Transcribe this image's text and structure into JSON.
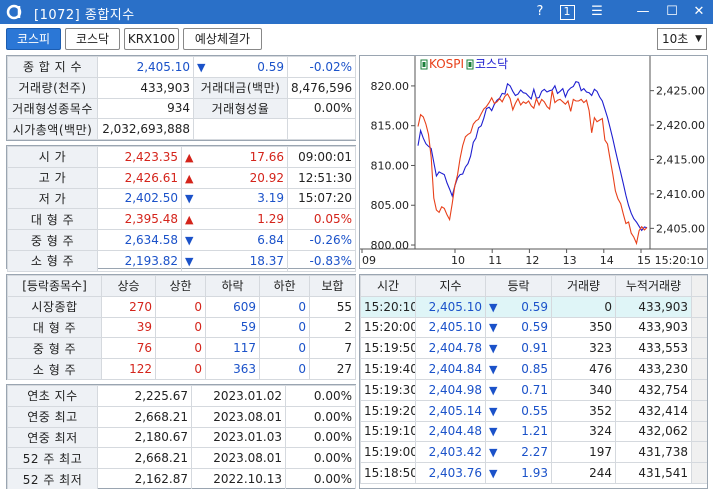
{
  "window": {
    "title": "[1072] 종합지수",
    "controls": [
      "?",
      "1",
      "☰",
      "—",
      "☐",
      "✕"
    ]
  },
  "tabs": [
    {
      "label": "코스피",
      "active": true
    },
    {
      "label": "코스닥",
      "active": false
    },
    {
      "label": "KRX100",
      "active": false
    },
    {
      "label": "예상체결가",
      "active": false
    }
  ],
  "interval": {
    "value": "10초"
  },
  "summary": {
    "rows": [
      {
        "label": "종 합 지 수",
        "value": "2,405.10",
        "arrow": "down",
        "change": "0.59",
        "pct": "-0.02%"
      },
      {
        "label": "거래량(천주)",
        "value": "433,903",
        "label2": "거래대금(백만)",
        "value2": "8,476,596"
      },
      {
        "label": "거래형성종목수",
        "value": "934",
        "label2": "거래형성율",
        "value2": "0.00%"
      },
      {
        "label": "시가총액(백만)",
        "value": "2,032,693,888"
      }
    ]
  },
  "prices": [
    {
      "label": "시 가",
      "value": "2,423.35",
      "arrow": "up",
      "change": "17.66",
      "extra": "09:00:01"
    },
    {
      "label": "고 가",
      "value": "2,426.61",
      "arrow": "up",
      "change": "20.92",
      "extra": "12:51:30"
    },
    {
      "label": "저 가",
      "value": "2,402.50",
      "arrow": "down",
      "change": "3.19",
      "extra": "15:07:20"
    },
    {
      "label": "대 형 주",
      "value": "2,395.48",
      "arrow": "up",
      "change": "1.29",
      "extra": "0.05%"
    },
    {
      "label": "중 형 주",
      "value": "2,634.58",
      "arrow": "down",
      "change": "6.84",
      "extra": "-0.26%"
    },
    {
      "label": "소 형 주",
      "value": "2,193.82",
      "arrow": "down",
      "change": "18.37",
      "extra": "-0.83%"
    }
  ],
  "breadth": {
    "headers": [
      "[등락종목수]",
      "상승",
      "상한",
      "하락",
      "하한",
      "보합"
    ],
    "rows": [
      {
        "label": "시장종합",
        "vals": [
          "270",
          "0",
          "609",
          "0",
          "55"
        ]
      },
      {
        "label": "대 형 주",
        "vals": [
          "39",
          "0",
          "59",
          "0",
          "2"
        ]
      },
      {
        "label": "중 형 주",
        "vals": [
          "76",
          "0",
          "117",
          "0",
          "7"
        ]
      },
      {
        "label": "소 형 주",
        "vals": [
          "122",
          "0",
          "363",
          "0",
          "27"
        ]
      }
    ]
  },
  "yearly": {
    "rows": [
      {
        "label": "연초 지수",
        "value": "2,225.67",
        "date": "2023.01.02",
        "pct": "0.00%"
      },
      {
        "label": "연중 최고",
        "value": "2,668.21",
        "date": "2023.08.01",
        "pct": "0.00%"
      },
      {
        "label": "연중 최저",
        "value": "2,180.67",
        "date": "2023.01.03",
        "pct": "0.00%"
      },
      {
        "label": "52 주 최고",
        "value": "2,668.21",
        "date": "2023.08.01",
        "pct": "0.00%"
      },
      {
        "label": "52 주 최저",
        "value": "2,162.87",
        "date": "2022.10.13",
        "pct": "0.00%"
      }
    ]
  },
  "ticks": {
    "headers": [
      "시간",
      "지수",
      "등락",
      "거래량",
      "누적거래량"
    ],
    "rows": [
      {
        "time": "15:20:10",
        "index": "2,405.10",
        "arrow": "down",
        "change": "0.59",
        "vol": "0",
        "cum": "433,903",
        "selected": true
      },
      {
        "time": "15:20:00",
        "index": "2,405.10",
        "arrow": "down",
        "change": "0.59",
        "vol": "350",
        "cum": "433,903"
      },
      {
        "time": "15:19:50",
        "index": "2,404.78",
        "arrow": "down",
        "change": "0.91",
        "vol": "323",
        "cum": "433,553"
      },
      {
        "time": "15:19:40",
        "index": "2,404.84",
        "arrow": "down",
        "change": "0.85",
        "vol": "476",
        "cum": "433,230"
      },
      {
        "time": "15:19:30",
        "index": "2,404.98",
        "arrow": "down",
        "change": "0.71",
        "vol": "340",
        "cum": "432,754"
      },
      {
        "time": "15:19:20",
        "index": "2,405.14",
        "arrow": "down",
        "change": "0.55",
        "vol": "352",
        "cum": "432,414"
      },
      {
        "time": "15:19:10",
        "index": "2,404.48",
        "arrow": "down",
        "change": "1.21",
        "vol": "324",
        "cum": "432,062"
      },
      {
        "time": "15:19:00",
        "index": "2,403.42",
        "arrow": "down",
        "change": "2.27",
        "vol": "197",
        "cum": "431,738"
      },
      {
        "time": "15:18:50",
        "index": "2,403.76",
        "arrow": "down",
        "change": "1.93",
        "vol": "244",
        "cum": "431,541"
      }
    ]
  },
  "chart_data": {
    "type": "line",
    "legend": [
      "KOSPI",
      "코스닥"
    ],
    "x_ticks": [
      "09",
      "10",
      "11",
      "12",
      "13",
      "14",
      "15",
      "15:20:10"
    ],
    "left_axis": {
      "ticks": [
        "820.00",
        "815.00",
        "810.00",
        "805.00",
        "800.00"
      ],
      "ylim": [
        799.5,
        822
      ]
    },
    "right_axis": {
      "ticks": [
        "2,425.00",
        "2,420.00",
        "2,415.00",
        "2,410.00",
        "2,405.00"
      ],
      "ylim": [
        2402,
        2428
      ]
    },
    "series": [
      {
        "name": "KOSPI",
        "color": "#1f1fd0",
        "axis": "right",
        "values": [
          2417.0,
          2419.2,
          2418.1,
          2417.3,
          2416.9,
          2416.6,
          2414.6,
          2412.6,
          2413.2,
          2413.0,
          2412.8,
          2411.6,
          2410.7,
          2409.7,
          2411.2,
          2412.3,
          2412.8,
          2412.9,
          2413.9,
          2414.4,
          2415.5,
          2417.5,
          2418.1,
          2419.6,
          2419.9,
          2421.0,
          2422.4,
          2422.6,
          2422.1,
          2423.0,
          2423.6,
          2423.9,
          2424.6,
          2424.5,
          2426.0,
          2425.7,
          2424.9,
          2424.3,
          2424.5,
          2425.1,
          2424.7,
          2424.6,
          2424.2,
          2423.8,
          2425.2,
          2423.9,
          2424.0,
          2424.9,
          2425.2,
          2424.8,
          2425.0,
          2425.1,
          2425.7,
          2424.6,
          2424.9,
          2425.3,
          2424.1,
          2425.0,
          2425.4,
          2425.6,
          2426.3,
          2426.2,
          2425.0,
          2425.3,
          2424.8,
          2424.7,
          2424.3,
          2425.2,
          2424.9,
          2424.1,
          2423.5,
          2422.3,
          2421.1,
          2419.6,
          2418.0,
          2416.3,
          2414.7,
          2413.1,
          2411.5,
          2409.8,
          2408.3,
          2407.2,
          2406.4,
          2405.9,
          2405.3,
          2404.7,
          2405.2,
          2405.1
        ]
      },
      {
        "name": "코스닥",
        "color": "#e8401a",
        "axis": "left",
        "values": [
          814.9,
          816.4,
          816.1,
          815.2,
          813.9,
          811.0,
          805.9,
          804.4,
          804.1,
          804.8,
          804.6,
          803.8,
          803.2,
          805.2,
          807.5,
          808.8,
          810.9,
          812.5,
          813.6,
          813.9,
          814.1,
          815.2,
          815.6,
          815.8,
          816.5,
          817.1,
          817.4,
          817.9,
          818.5,
          817.8,
          818.0,
          818.4,
          818.0,
          818.7,
          819.0,
          818.4,
          817.0,
          817.8,
          818.4,
          817.6,
          818.0,
          817.8,
          818.1,
          817.5,
          817.2,
          818.4,
          817.6,
          818.3,
          818.0,
          817.4,
          817.1,
          819.4,
          817.9,
          818.2,
          818.3,
          818.0,
          817.7,
          818.1,
          816.8,
          818.3,
          818.1,
          818.1,
          818.3,
          817.9,
          818.2,
          816.9,
          814.1,
          816.0,
          815.5,
          815.7,
          815.9,
          813.2,
          812.7,
          810.8,
          808.9,
          806.8,
          805.8,
          805.2,
          803.9,
          802.7,
          802.9,
          801.5,
          801.0,
          800.2,
          801.8,
          802.3,
          801.9,
          802.2
        ]
      }
    ]
  }
}
